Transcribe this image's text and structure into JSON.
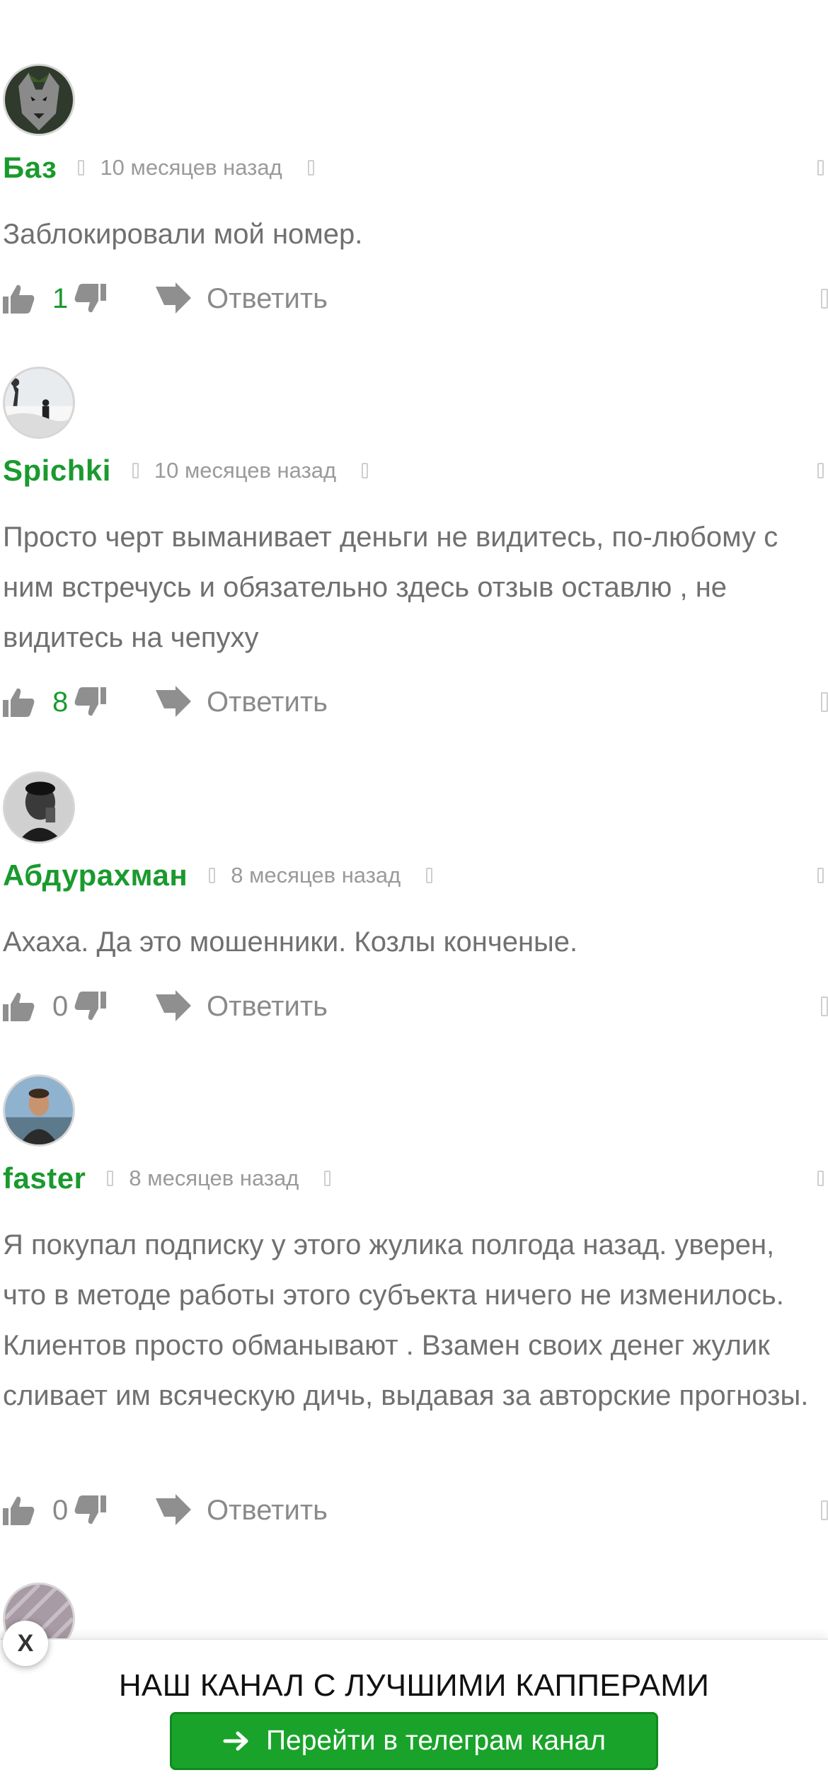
{
  "comments": [
    {
      "author": "Баз",
      "time": "10 месяцев назад",
      "text": "Заблокировали мой номер.",
      "likes": "1",
      "reply_label": "Ответить",
      "avatar_icon": "wolf-avatar"
    },
    {
      "author": "Spichki",
      "time": "10 месяцев назад",
      "text": "Просто черт выманивает деньги не видитесь, по-любому с ним встречусь и обязательно здесь отзыв оставлю , не видитесь на чепуху",
      "likes": "8",
      "reply_label": "Ответить",
      "avatar_icon": "snow-landscape-avatar"
    },
    {
      "author": "Абдурахман",
      "time": "8 месяцев назад",
      "text": "Ахаха. Да это мошенники. Козлы конченые.",
      "likes": "0",
      "reply_label": "Ответить",
      "avatar_icon": "bw-portrait-avatar"
    },
    {
      "author": "faster",
      "time": "8 месяцев назад",
      "text": "Я покупал подписку у этого жулика полгода назад. уверен, что в методе работы этого субъекта ничего не изменилось. Клиентов просто обманывают . Взамен своих денег жулик сливает им всяческую дичь, выдавая за авторские прогнозы.",
      "likes": "0",
      "reply_label": "Ответить",
      "avatar_icon": "man-outdoor-avatar"
    }
  ],
  "banner": {
    "close_label": "X",
    "title": "НАШ КАНАЛ С ЛУЧШИМИ КАППЕРАМИ",
    "button_label": "Перейти в телеграм канал",
    "button_icon": "arrow-right-icon"
  },
  "colors": {
    "author": "#1a9a2e",
    "likes_positive": "#1a9a2e",
    "text": "#707070",
    "button": "#1aa32a"
  }
}
